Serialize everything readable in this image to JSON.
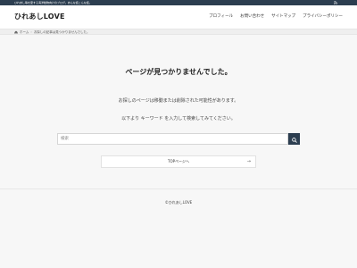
{
  "topbar": {
    "description": "ひれあし等を愛する海洋動物向けのブログ。あんな話こんな話。",
    "rss_icon": "rss-icon",
    "search_icon": "search-icon"
  },
  "header": {
    "site_title": "ひれあしLOVE",
    "nav": [
      {
        "label": "プロフィール"
      },
      {
        "label": "お問い合わせ"
      },
      {
        "label": "サイトマップ"
      },
      {
        "label": "プライバシーポリシー"
      }
    ]
  },
  "breadcrumb": {
    "home_label": "ホーム",
    "separator": "›",
    "current": "お探しの記事は見つかりませんでした。"
  },
  "main": {
    "heading": "ページが見つかりませんでした。",
    "message1": "お探しのページは移動または削除された可能性があります。",
    "message2": "以下より キーワード を入力して検索してみてください。",
    "search": {
      "placeholder": "検索",
      "value": ""
    },
    "top_button_label": "TOPページへ",
    "top_button_arrow": "→"
  },
  "footer": {
    "copyright": "©ひれあしLOVE"
  },
  "colors": {
    "accent": "#2c3e50",
    "background": "#f7f7f7"
  }
}
